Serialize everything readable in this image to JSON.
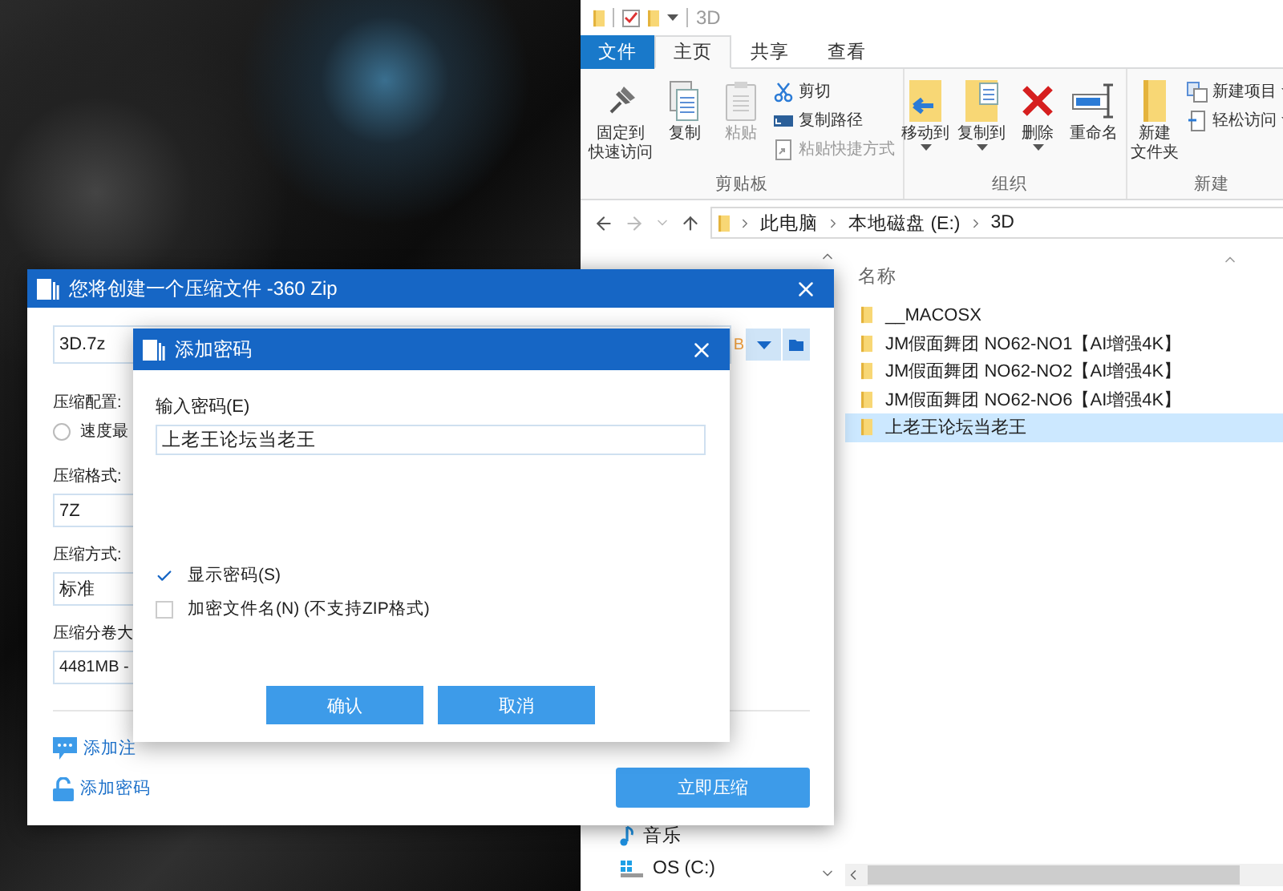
{
  "explorer": {
    "title": "3D",
    "ribbon_tabs": [
      {
        "label": "文件",
        "kind": "file",
        "selected": false
      },
      {
        "label": "主页",
        "kind": "tab",
        "selected": true
      },
      {
        "label": "共享",
        "kind": "tab",
        "selected": false
      },
      {
        "label": "查看",
        "kind": "tab",
        "selected": false
      }
    ],
    "ribbon_groups": [
      {
        "label": "剪贴板",
        "items": [
          {
            "lines": [
              "固定到",
              "快速访问"
            ],
            "kind": "large",
            "disabled": false,
            "dropdown": false
          },
          {
            "lines": [
              "复制"
            ],
            "kind": "large",
            "disabled": false,
            "dropdown": false
          },
          {
            "lines": [
              "粘贴"
            ],
            "kind": "large",
            "disabled": true,
            "dropdown": false
          },
          {
            "lines": [
              "剪切"
            ],
            "kind": "small",
            "disabled": false,
            "dropdown": false
          },
          {
            "lines": [
              "复制路径"
            ],
            "kind": "small",
            "disabled": false,
            "dropdown": false
          },
          {
            "lines": [
              "粘贴快捷方式"
            ],
            "kind": "small",
            "disabled": true,
            "dropdown": false
          }
        ]
      },
      {
        "label": "组织",
        "items": [
          {
            "lines": [
              "移动到"
            ],
            "kind": "large",
            "disabled": false,
            "dropdown": true
          },
          {
            "lines": [
              "复制到"
            ],
            "kind": "large",
            "disabled": false,
            "dropdown": true
          },
          {
            "lines": [
              "删除"
            ],
            "kind": "large",
            "disabled": false,
            "dropdown": true
          },
          {
            "lines": [
              "重命名"
            ],
            "kind": "large",
            "disabled": false,
            "dropdown": false
          }
        ]
      },
      {
        "label": "新建",
        "items": [
          {
            "lines": [
              "新建",
              "文件夹"
            ],
            "kind": "large",
            "disabled": false,
            "dropdown": false
          },
          {
            "lines": [
              "新建项目"
            ],
            "kind": "small",
            "disabled": false,
            "dropdown": true
          },
          {
            "lines": [
              "轻松访问"
            ],
            "kind": "small",
            "disabled": false,
            "dropdown": true
          }
        ]
      }
    ],
    "path": [
      "此电脑",
      "本地磁盘 (E:)",
      "3D"
    ],
    "nav_items": [
      {
        "label": "音乐",
        "kind": "music"
      },
      {
        "label": "OS (C:)",
        "kind": "drive"
      }
    ],
    "column": "名称",
    "rows": [
      {
        "name": "__MACOSX",
        "selected": false
      },
      {
        "name": "JM假面舞团 NO62-NO1【AI增强4K】",
        "selected": false
      },
      {
        "name": "JM假面舞团 NO62-NO2【AI增强4K】",
        "selected": false
      },
      {
        "name": "JM假面舞团 NO62-NO6【AI增强4K】",
        "selected": false
      },
      {
        "name": "上老王论坛当老王",
        "selected": true
      }
    ]
  },
  "zip_dialog": {
    "title": "您将创建一个压缩文件 -360 Zip",
    "filename": "3D.7z",
    "size_fragment": "B",
    "config_label": "压缩配置:",
    "radio_options": [
      {
        "label": "速度最",
        "selected": false
      }
    ],
    "format_label": "压缩格式:",
    "format_value": "7Z",
    "method_label": "压缩方式:",
    "method_value": "标准",
    "split_label": "压缩分卷大",
    "split_value": "4481MB -",
    "links": [
      {
        "label": "添加注",
        "kind": "comment"
      },
      {
        "label": "添加密码",
        "kind": "lock"
      }
    ],
    "primary_button": "立即压缩"
  },
  "password_dialog": {
    "title": "添加密码",
    "field_label": "输入密码(E)",
    "value": "上老王论坛当老王",
    "options": [
      {
        "label": "显示密码(S)",
        "checked": true
      },
      {
        "label": "加密文件名(N) (不支持ZIP格式)",
        "checked": false
      }
    ],
    "buttons": [
      "确认",
      "取消"
    ]
  }
}
